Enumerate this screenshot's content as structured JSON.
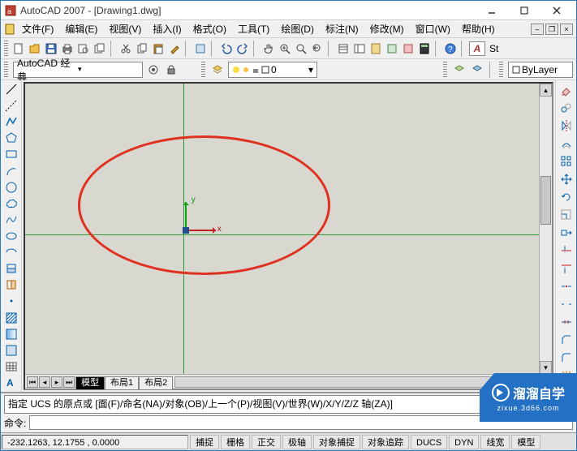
{
  "app": {
    "title": "AutoCAD 2007 - [Drawing1.dwg]"
  },
  "menu": {
    "file": "文件(F)",
    "edit": "编辑(E)",
    "view": "视图(V)",
    "insert": "插入(I)",
    "format": "格式(O)",
    "tools": "工具(T)",
    "draw": "绘图(D)",
    "dimension": "标注(N)",
    "modify": "修改(M)",
    "window": "窗口(W)",
    "help": "帮助(H)"
  },
  "workspace": {
    "current": "AutoCAD 经典"
  },
  "layer": {
    "current": "0",
    "bylayer": "ByLayer"
  },
  "style": {
    "label": "St"
  },
  "tabs": {
    "model": "模型",
    "layout1": "布局1",
    "layout2": "布局2"
  },
  "ucs": {
    "x": "x",
    "y": "y"
  },
  "command": {
    "history": "指定 UCS 的原点或 [面(F)/命名(NA)/对象(OB)/上一个(P)/视图(V)/世界(W)/X/Y/Z/Z 轴(ZA)]",
    "prompt": "命令:",
    "input": ""
  },
  "status": {
    "coords": "-232.1263, 12.1755   , 0.0000",
    "snap": "捕捉",
    "grid": "栅格",
    "ortho": "正交",
    "polar": "极轴",
    "osnap": "对象捕捉",
    "otrack": "对象追踪",
    "ducs": "DUCS",
    "dyn": "DYN",
    "lwt": "线宽",
    "model": "模型"
  },
  "watermark": {
    "brand": "溜溜自学",
    "url": "zixue.3d66.com"
  },
  "a": "A"
}
